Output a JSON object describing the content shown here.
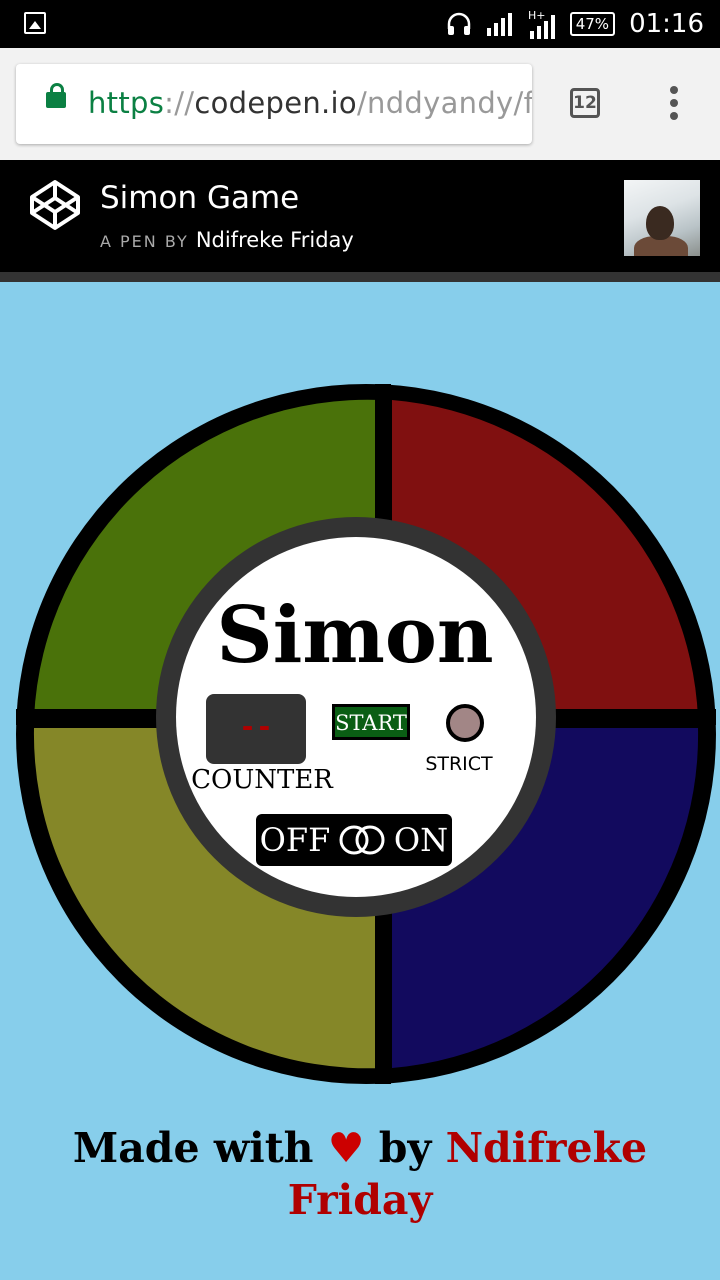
{
  "status_bar": {
    "battery": "47%",
    "time": "01:16"
  },
  "browser": {
    "url_scheme": "https",
    "url_sep": "://",
    "url_host": "codepen.io",
    "url_path": "/nddyandy/f",
    "tab_count": "12"
  },
  "codepen": {
    "pen_title": "Simon Game",
    "byline_prefix": "A PEN BY",
    "author": "Ndifreke Friday"
  },
  "game": {
    "title": "Simon",
    "counter_display": "--",
    "counter_label": "COUNTER",
    "start_label": "START",
    "strict_label": "STRICT",
    "off_label": "OFF",
    "on_label": "ON",
    "colors": {
      "green": "#4a720a",
      "red": "#801010",
      "yellow": "#858728",
      "blue": "#120a5e",
      "background": "#87ceeb"
    }
  },
  "credit": {
    "made_with": "Made with",
    "heart": "♥",
    "by": "by",
    "author": "Ndifreke Friday"
  }
}
